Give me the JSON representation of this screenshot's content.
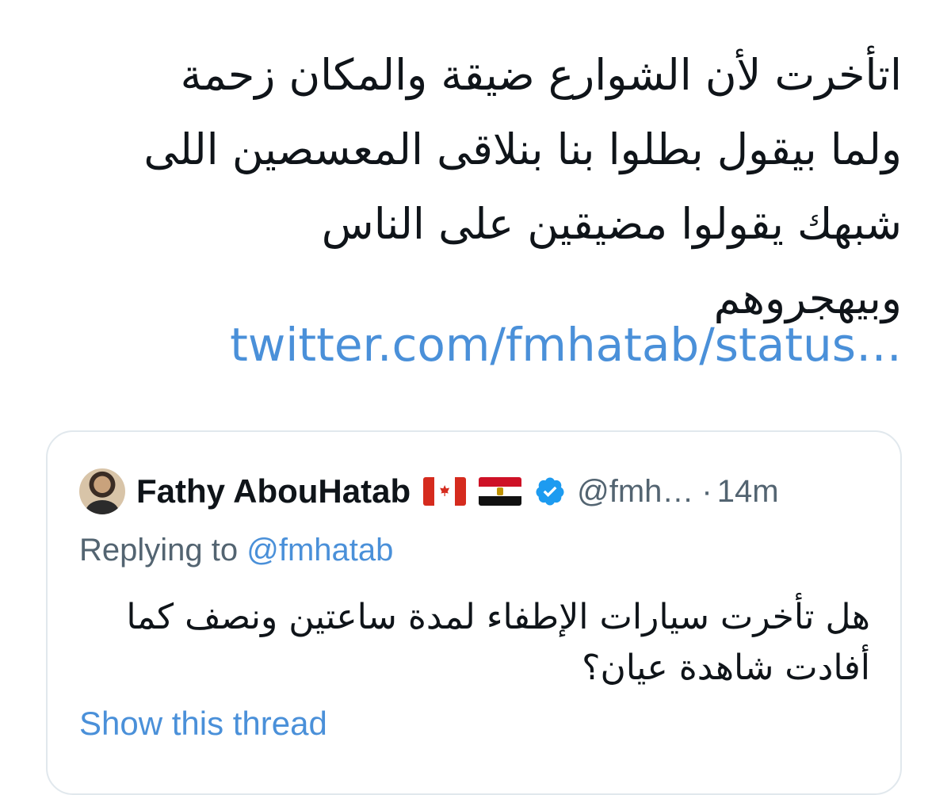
{
  "tweet": {
    "text_lines": [
      "اتأخرت لأن الشوارع ضيقة والمكان زحمة",
      "ولما بيقول بطلوا بنا بنلاقى المعسصين اللى",
      "شبهك يقولوا مضيقين على الناس",
      "وبيهجروهم"
    ],
    "link": "twitter.com/fmhatab/status…"
  },
  "quoted_tweet": {
    "author_name": "Fathy AbouHatab",
    "flags": [
      "canada-flag-icon",
      "egypt-flag-icon"
    ],
    "verified": true,
    "handle": "@fmh…",
    "separator": "·",
    "time": "14m",
    "replying_prefix": "Replying to",
    "replying_mention": "@fmhatab",
    "text_lines": [
      "هل تأخرت سيارات الإطفاء لمدة ساعتين ونصف كما",
      "أفادت شاهدة عيان؟"
    ],
    "show_thread": "Show this thread"
  },
  "colors": {
    "text": "#0f1419",
    "secondary": "#536471",
    "link": "#4a90d9",
    "verified": "#1d9bf0",
    "card_border": "#e1e8ed"
  }
}
